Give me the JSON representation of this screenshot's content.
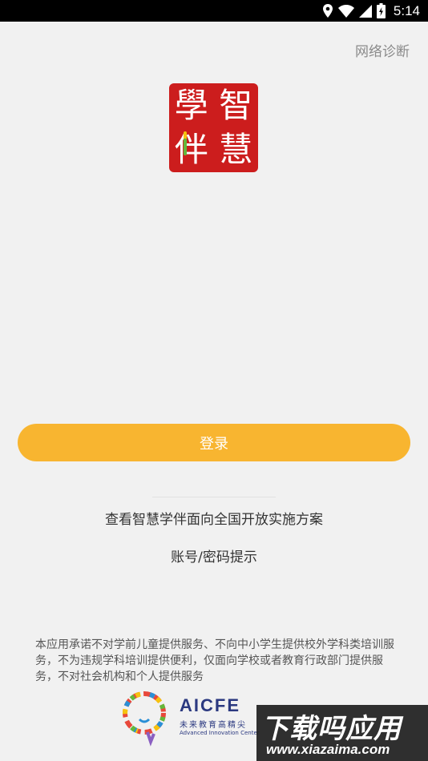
{
  "status_bar": {
    "time": "5:14",
    "icons": [
      "location-icon",
      "wifi-icon",
      "signal-icon",
      "battery-icon"
    ]
  },
  "header": {
    "net_diag_label": "网络诊断"
  },
  "logo": {
    "chars": [
      "學",
      "智",
      "伴",
      "慧"
    ]
  },
  "login": {
    "label": "登录"
  },
  "links": {
    "plan": "查看智慧学伴面向全国开放实施方案",
    "account_hint": "账号/密码提示"
  },
  "disclaimer": "本应用承诺不对学前儿童提供服务、不向中小学生提供校外学科类培训服务，不为违规学科培训提供便利，仅面向学校或者教育行政部门提供服务，不对社会机构和个人提供服务",
  "footer_logo": {
    "name": "AICFE",
    "cn": "未来教育高精尖",
    "en": "Advanced Innovation Center"
  },
  "watermark": {
    "title": "下载吗应用",
    "url": "www.xiazaima.com"
  },
  "colors": {
    "background": "#f1f1f1",
    "accent": "#f8b530",
    "logo_red": "#cc1d1d",
    "aicfe_blue": "#2b3980"
  }
}
